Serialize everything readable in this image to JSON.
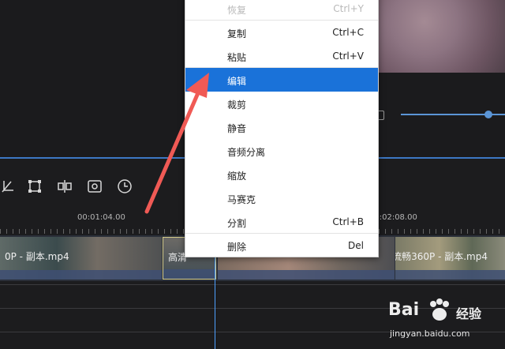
{
  "timeline": {
    "ruler": {
      "t1": "00:01:04.00",
      "t2": "00:02:08.00"
    },
    "clips": [
      {
        "label": "0P - 副本.mp4"
      },
      {
        "label": "高清"
      },
      {
        "label": ""
      },
      {
        "label": "》- 流畅360P - 副本.mp4"
      }
    ]
  },
  "context_menu": {
    "items": [
      {
        "label": "恢复",
        "shortcut": "Ctrl+Y",
        "state": "disabled"
      },
      {
        "label": "复制",
        "shortcut": "Ctrl+C"
      },
      {
        "label": "粘贴",
        "shortcut": "Ctrl+V"
      },
      {
        "label": "编辑",
        "shortcut": "",
        "state": "active"
      },
      {
        "label": "裁剪",
        "shortcut": ""
      },
      {
        "label": "静音",
        "shortcut": ""
      },
      {
        "label": "音频分离",
        "shortcut": ""
      },
      {
        "label": "缩放",
        "shortcut": ""
      },
      {
        "label": "马赛克",
        "shortcut": ""
      },
      {
        "label": "分割",
        "shortcut": "Ctrl+B"
      },
      {
        "label": "删除",
        "shortcut": "Del"
      }
    ]
  },
  "toolbar": {
    "icons": [
      "crop-icon",
      "transform-icon",
      "split-icon",
      "record-icon",
      "clock-icon"
    ]
  },
  "colors": {
    "accent": "#1a72d9",
    "arrow": "#f05a55",
    "playhead": "#4da0ff"
  },
  "watermark": {
    "brand": "Bai",
    "brand2": "经验",
    "url": "jingyan.baidu.com"
  }
}
